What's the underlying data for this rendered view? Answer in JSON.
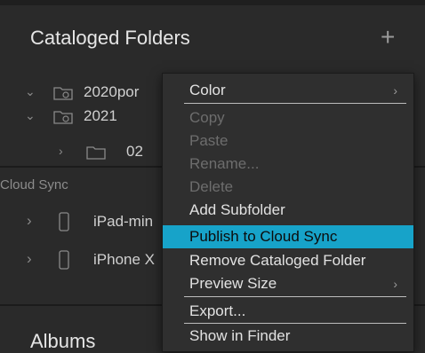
{
  "cataloged": {
    "title": "Cataloged Folders",
    "add_symbol": "+",
    "folders": [
      {
        "label": "2020por",
        "expanded": true
      },
      {
        "label": "2021",
        "expanded": true
      },
      {
        "label": "02",
        "expanded": false
      }
    ]
  },
  "cloud_sync": {
    "title": "Cloud Sync",
    "devices": [
      {
        "label": "iPad-min"
      },
      {
        "label": "iPhone X"
      }
    ]
  },
  "albums": {
    "title": "Albums"
  },
  "context_menu": {
    "items": [
      {
        "label": "Color",
        "enabled": true,
        "submenu": true
      },
      {
        "label": "Copy",
        "enabled": false
      },
      {
        "label": "Paste",
        "enabled": false
      },
      {
        "label": "Rename...",
        "enabled": false
      },
      {
        "label": "Delete",
        "enabled": false
      },
      {
        "label": "Add Subfolder",
        "enabled": true
      },
      {
        "label": "Publish to Cloud Sync",
        "enabled": true,
        "highlighted": true
      },
      {
        "label": "Remove Cataloged Folder",
        "enabled": true
      },
      {
        "label": "Preview Size",
        "enabled": true,
        "submenu": true
      },
      {
        "label": "Export...",
        "enabled": true
      },
      {
        "label": "Show in Finder",
        "enabled": true
      }
    ],
    "highlight_color": "#17a3c9",
    "submenu_arrow": "›"
  }
}
